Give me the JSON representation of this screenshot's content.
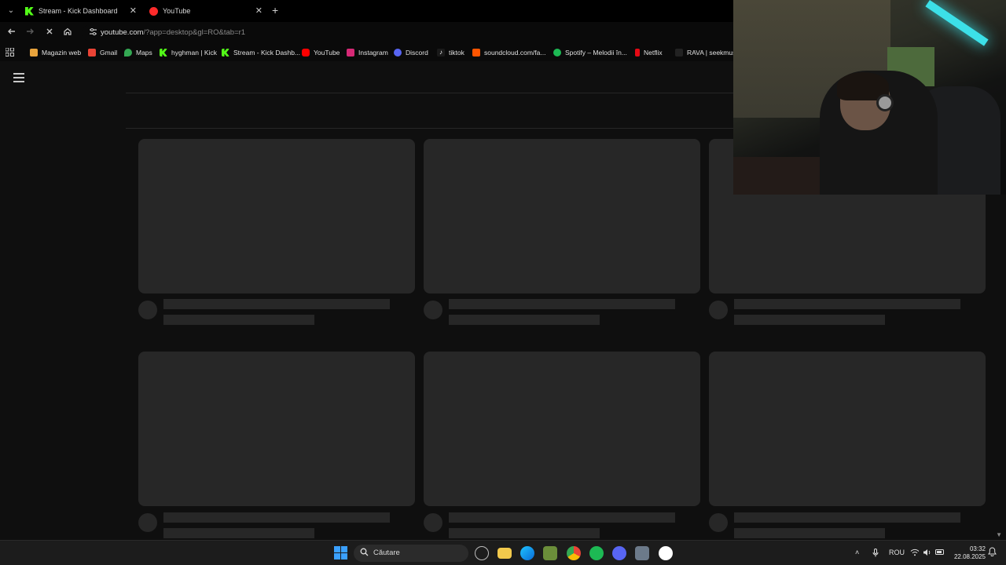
{
  "tabs": [
    {
      "title": "Stream - Kick Dashboard",
      "favicon": "kick-icon",
      "close": "✕"
    },
    {
      "title": "YouTube",
      "favicon": "youtube-icon",
      "close": "✕"
    }
  ],
  "new_tab_glyph": "+",
  "omnibox": {
    "host": "youtube.com",
    "path": "/?app=desktop&gl=RO&tab=r1"
  },
  "bookmarks": [
    {
      "label": "Magazin web",
      "icon": "web-store-icon",
      "color": "#e8a33c"
    },
    {
      "label": "Gmail",
      "icon": "gmail-icon",
      "color": "#ea4335"
    },
    {
      "label": "Maps",
      "icon": "maps-icon",
      "color": "#34a853"
    },
    {
      "label": "hyghman | Kick",
      "icon": "kick-icon",
      "color": "#53fc18"
    },
    {
      "label": "Stream - Kick Dashb...",
      "icon": "kick-icon",
      "color": "#53fc18"
    },
    {
      "label": "YouTube",
      "icon": "youtube-icon",
      "color": "#ff0000"
    },
    {
      "label": "Instagram",
      "icon": "instagram-icon",
      "color": "#d62976"
    },
    {
      "label": "Discord",
      "icon": "discord-icon",
      "color": "#5865f2"
    },
    {
      "label": "tiktok",
      "icon": "tiktok-icon",
      "color": "#ffffff"
    },
    {
      "label": "soundcloud.com/fa...",
      "icon": "soundcloud-icon",
      "color": "#ff5500"
    },
    {
      "label": "Spotify – Melodii în...",
      "icon": "spotify-icon",
      "color": "#1db954"
    },
    {
      "label": "Netflix",
      "icon": "netflix-icon",
      "color": "#e50914"
    },
    {
      "label": "RAVA | seekmusic",
      "icon": "rava-icon",
      "color": "#222222"
    }
  ],
  "taskbar": {
    "search_placeholder": "Căutare",
    "language": "ROU",
    "time": "03:32",
    "date": "22.08.2025"
  },
  "colors": {
    "page_bg": "#0f0f0f",
    "skeleton": "#272727"
  }
}
